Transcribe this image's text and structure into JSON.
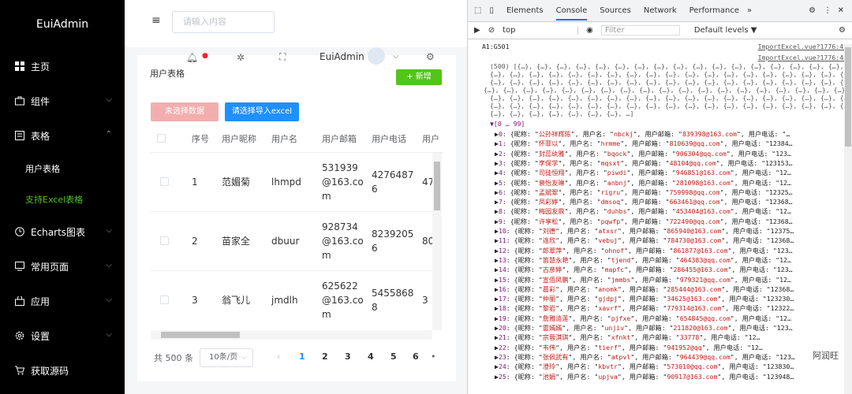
{
  "sidebar": {
    "logo": "EuiAdmin",
    "items": [
      {
        "label": "主页",
        "icon": "grid-icon"
      },
      {
        "label": "组件",
        "icon": "briefcase-icon"
      },
      {
        "label": "表格",
        "icon": "doc-icon"
      },
      {
        "label": "Echarts图表",
        "icon": "clock-icon"
      },
      {
        "label": "常用页面",
        "icon": "monitor-icon"
      },
      {
        "label": "应用",
        "icon": "bag-icon"
      },
      {
        "label": "设置",
        "icon": "gear-icon"
      },
      {
        "label": "获取源码",
        "icon": "cart-icon"
      }
    ],
    "sub_items": [
      {
        "label": "用户表格"
      },
      {
        "label": "支持Excel表格"
      }
    ]
  },
  "header": {
    "search_placeholder": "请输入内容",
    "username": "EuiAdmin"
  },
  "card": {
    "title": "用户表格",
    "add_label": "+ 新增",
    "disabled_btn": "未选择数据",
    "import_btn": "请选择导入excel"
  },
  "table": {
    "headers": [
      "序号",
      "用户昵称",
      "用户名",
      "用户邮箱",
      "用户电话",
      "用户"
    ],
    "rows": [
      {
        "no": "1",
        "nick": "范媚菊",
        "user": "lhmpd",
        "email": [
          "531939",
          "@163.co",
          "m"
        ],
        "phone": [
          "4276487",
          "6"
        ],
        "extra": "47"
      },
      {
        "no": "2",
        "nick": "苗家全",
        "user": "dbuur",
        "email": [
          "928734",
          "@163.co",
          "m"
        ],
        "phone": [
          "8239205",
          "6"
        ],
        "extra": "80"
      },
      {
        "no": "3",
        "nick": "翁飞儿",
        "user": "jmdlh",
        "email": [
          "625622",
          "@163.co",
          "m"
        ],
        "phone": [
          "5455868",
          "8"
        ],
        "extra": "3"
      }
    ]
  },
  "pager": {
    "total": "共 500 条",
    "size": "10条/页",
    "pages": [
      "1",
      "2",
      "3",
      "4",
      "5",
      "6"
    ],
    "current": "1"
  },
  "devtools": {
    "tabs": [
      "Elements",
      "Console",
      "Sources",
      "Network",
      "Performance"
    ],
    "active_tab": "Console",
    "context": "top",
    "filter_placeholder": "Filter",
    "levels": "Default levels ▼",
    "cell_ref": "A1:G501",
    "source": "ImportExcel.vue?1776:41",
    "source2": "ImportExcel.vue?1776:48",
    "array_head": "(500) [{…}, {…}, {…}, {…}, {…}, {…}, {…}, {…}, {…}, {…}, {…}, {…}, {…}, {…}, {…}, {…}, {…},",
    "array_line": "{…}, {…}, {…}, {…}, {…}, {…}, {…}, {…}, {…}, {…}, {…}, {…}, {…}, {…}, {…}, {…}, {…}, {…}, {…},",
    "array_tail": "{…}, {…}, {…}, {…}, {…}, {…}, {…}, …]",
    "range": "▼[0 … 99]",
    "entries": [
      {
        "i": "0",
        "nick": "公孙祥辉陈",
        "user": "nbckj",
        "mail": "839398@163.com"
      },
      {
        "i": "1",
        "nick": "怀菲以",
        "user": "hrmme",
        "mail": "810639@qq.com"
      },
      {
        "i": "2",
        "nick": "封蕊纨雅",
        "user": "bqock",
        "mail": "906304@qq.com"
      },
      {
        "i": "3",
        "nick": "李保学",
        "user": "mqsxt",
        "mail": "48104@qq.com"
      },
      {
        "i": "4",
        "nick": "司徒恒翔",
        "user": "piwdi",
        "mail": "946851@163.com"
      },
      {
        "i": "5",
        "nick": "裴怡友琳",
        "user": "anbnj",
        "mail": "281098@163.com"
      },
      {
        "i": "6",
        "nick": "孟斌翠",
        "user": "rigru",
        "mail": "759998@qq.com"
      },
      {
        "i": "7",
        "nick": "凤彩婷",
        "user": "dmsoq",
        "mail": "663461@qq.com"
      },
      {
        "i": "8",
        "nick": "梅园友鼎",
        "user": "duhbs",
        "mail": "453404@163.com"
      },
      {
        "i": "9",
        "nick": "许享松",
        "user": "pqwfp",
        "mail": "722490@qq.com"
      },
      {
        "i": "10",
        "nick": "刘德",
        "user": "atxsr",
        "mail": "865940@163.com"
      },
      {
        "i": "11",
        "nick": "连欣",
        "user": "vebuj",
        "mail": "784730@163.com"
      },
      {
        "i": "12",
        "nick": "郎翠萍",
        "user": "ohnof",
        "mail": "861877@163.com"
      },
      {
        "i": "13",
        "nick": "笛慧永艳",
        "user": "tjend",
        "mail": "464383@qq.com"
      },
      {
        "i": "14",
        "nick": "古彦婷",
        "user": "mapfc",
        "mail": "286455@163.com"
      },
      {
        "i": "15",
        "nick": "宣佰凤鹏",
        "user": "jmmbs",
        "mail": "979321@qq.com"
      },
      {
        "i": "16",
        "nick": "葛彩",
        "user": "anomk",
        "mail": "285444@163.com"
      },
      {
        "i": "17",
        "nick": "仲丽",
        "user": "gjdpj",
        "mail": "34625@163.com"
      },
      {
        "i": "18",
        "nick": "黎岩",
        "user": "xavrf",
        "mail": "779314@163.com"
      },
      {
        "i": "19",
        "nick": "詹雅涟莲",
        "user": "pjfxe",
        "mail": "654845@qq.com"
      },
      {
        "i": "20",
        "nick": "雷嫣嫣",
        "user": "unjiv",
        "mail": "211820@163.com"
      },
      {
        "i": "21",
        "nick": "宗蓉淇琪",
        "user": "xfnkt",
        "mail": "33778"
      },
      {
        "i": "22",
        "nick": "韦伟",
        "user": "tierf",
        "mail": "941952@qq"
      },
      {
        "i": "23",
        "nick": "张佩武有",
        "user": "atpvl",
        "mail": "964439@qq.com"
      },
      {
        "i": "24",
        "nick": "澄玲",
        "user": "kbvtr",
        "mail": "573010@qq.com"
      },
      {
        "i": "25",
        "nick": "池娟",
        "user": "upjva",
        "mail": "90917@163.com"
      }
    ],
    "tails": [
      "用户电话: \"…",
      "用户电话: \"12384…",
      "用户电话: \"123…",
      "用户电话: \"123153…",
      "用户电话: \"12…",
      "用户电话: \"12…",
      "用户电话: \"12325…",
      "用户电话: \"12368…",
      "用户电话: \"12…",
      "用户电话: \"12368…",
      "用户电话: \"12375…",
      "用户电话: \"12368…",
      "用户电话: \"123…",
      "用户电话: \"12…",
      "用户电话: \"123…",
      "用户电话: \"12…",
      "用户电话: \"12368…",
      "用户电话: \"123230…",
      "用户电话: \"12322…",
      "用户电话: \"12…",
      "用户电话: \"123…",
      "用户电话: \"12…",
      "用户电话: \"12…",
      "用户电话: \"123…",
      "用户电话: \"123830…",
      "用户电话: \"123948…"
    ],
    "nick_key": "{昵称: ",
    "user_key": "用户名: ",
    "mail_key": "用户邮箱: ",
    "watermark": "阿润旺"
  }
}
